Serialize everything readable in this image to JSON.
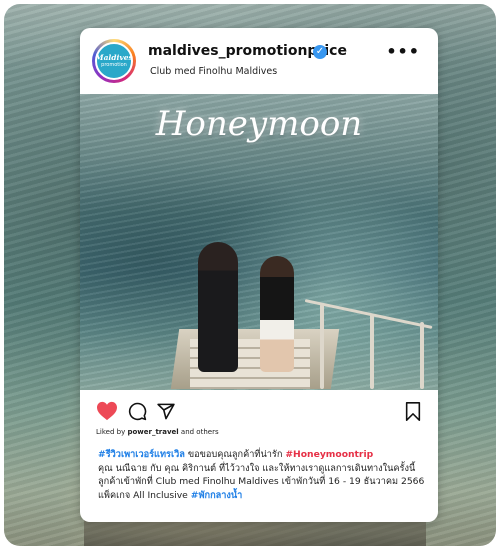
{
  "post": {
    "username": "maldives_promotionprice",
    "location": "Club med Finolhu Maldives",
    "more_label": "•••",
    "avatar": {
      "line1": "Maldives",
      "line2": "promotion"
    },
    "photo_title": "Honeymoon",
    "liked_by_prefix": "Liked by",
    "liked_by_user": "power_travel",
    "liked_by_suffix": "and others",
    "caption": {
      "line1_tag": "#รีวิวเพาเวอร์แทรเวิล",
      "line1_text": " ขอขอบคุณลูกค้าที่น่ารัก ",
      "line1_tag2": "#Honeymoontrip",
      "line2": "คุณ นณีฉาย กับ คุณ คิริกานต์ ที่ไว้วางใจ และให้ทางเราดูแลการเดินทางในครั้งนี้",
      "line3": "ลูกค้าเข้าพักที่ Club med Finolhu Maldives เข้าพักวันที่ 16 - 19 ธันวาคม 2566",
      "line4_text": "แพ็คเกจ All Inclusive ",
      "line4_tag": "#พักกลางน้ำ"
    }
  },
  "colors": {
    "like_red": "#ed4956",
    "tag_blue": "#1f7fe6",
    "tag_red": "#e63046",
    "verified_blue": "#3897f0"
  }
}
